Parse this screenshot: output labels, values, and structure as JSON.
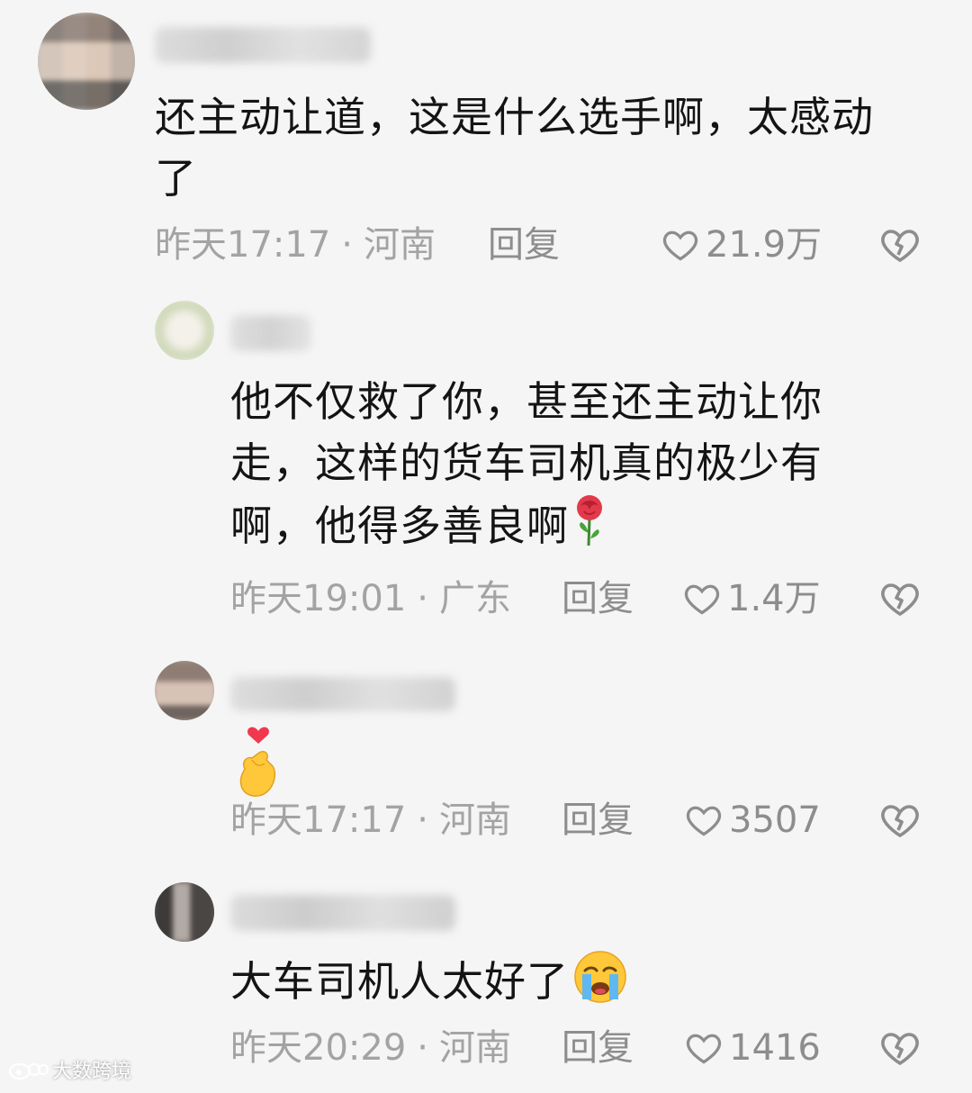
{
  "comments": [
    {
      "lines": [
        "还主动让道，这是什么选手啊，太感动",
        "了"
      ],
      "time": "昨天17:17",
      "location": "河南",
      "reply_label": "回复",
      "likes": "21.9万"
    },
    {
      "lines": [
        "他不仅救了你，甚至还主动让你",
        "走，这样的货车司机真的极少有",
        "啊，他得多善良啊"
      ],
      "time": "昨天19:01",
      "location": "广东",
      "reply_label": "回复",
      "likes": "1.4万",
      "emoji": "rose-emoji"
    },
    {
      "lines": [],
      "time": "昨天17:17",
      "location": "河南",
      "reply_label": "回复",
      "likes": "3507",
      "emoji": "finger-heart-emoji"
    },
    {
      "lines": [
        "大车司机人太好了"
      ],
      "time": "昨天20:29",
      "location": "河南",
      "reply_label": "回复",
      "likes": "1416",
      "emoji": "crying-face-emoji"
    }
  ],
  "separator": "·",
  "watermark": "大数跨境",
  "colors": {
    "background": "#f5f5f5",
    "text": "#141414",
    "meta": "#a3a3a3",
    "action": "#8d8d8d",
    "heart_red": "#e8424f"
  },
  "icons": [
    "heart-outline-icon",
    "broken-heart-icon"
  ]
}
